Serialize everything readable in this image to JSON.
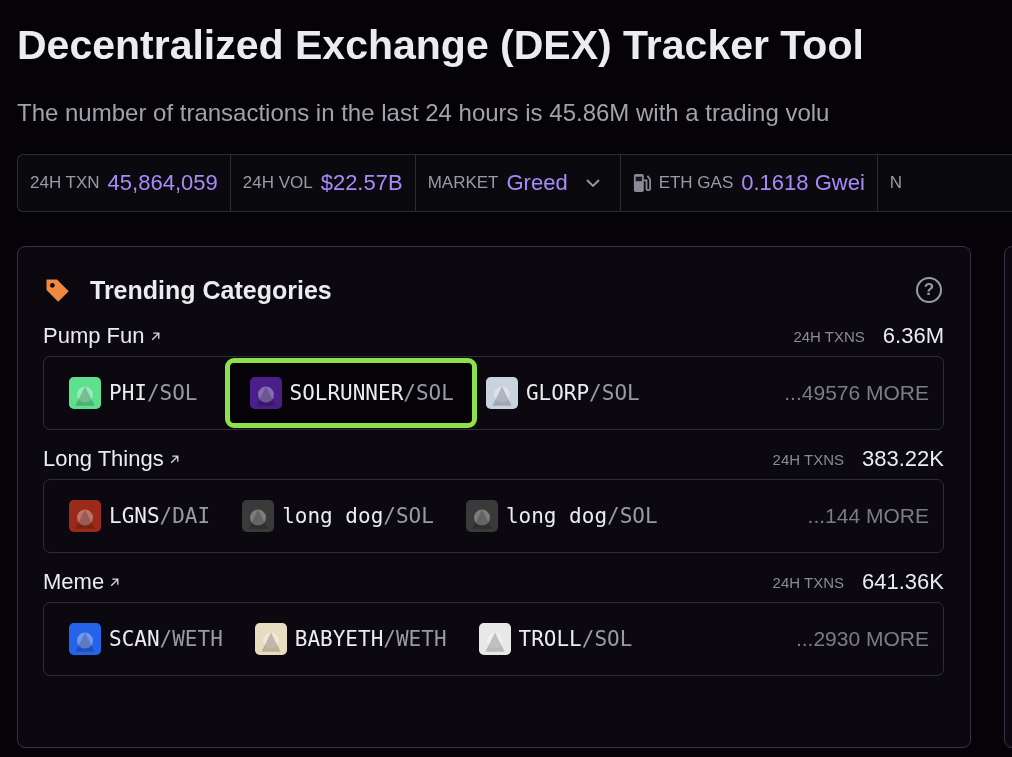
{
  "page": {
    "title": "Decentralized Exchange (DEX) Tracker Tool",
    "subtitle": "The number of transactions in the last 24 hours is 45.86M with a trading volu"
  },
  "stats": [
    {
      "kind": "plain",
      "label": "24H TXN",
      "value": "45,864,059"
    },
    {
      "kind": "plain",
      "label": "24H VOL",
      "value": "$22.57B"
    },
    {
      "kind": "dropdown",
      "label": "MARKET",
      "value": "Greed"
    },
    {
      "kind": "gas",
      "label": "ETH GAS",
      "value": "0.1618 Gwei"
    },
    {
      "kind": "plain",
      "label": "N"
    }
  ],
  "trending": {
    "title": "Trending Categories",
    "help": "?",
    "categories": [
      {
        "name": "Pump Fun",
        "metric_label": "24H TXNS",
        "metric": "6.36M",
        "more": "...49576 MORE",
        "pairs": [
          {
            "base": "PHI",
            "quote": "/SOL",
            "color": "#5ee08f",
            "highlighted": false
          },
          {
            "base": "SOLRUNNER",
            "quote": "/SOL",
            "color": "#4a1f8a",
            "highlighted": true
          },
          {
            "base": "GLORP",
            "quote": "/SOL",
            "color": "#c9d3e0",
            "highlighted": false
          }
        ]
      },
      {
        "name": "Long Things",
        "metric_label": "24H TXNS",
        "metric": "383.22K",
        "more": "...144 MORE",
        "pairs": [
          {
            "base": "LGNS",
            "quote": "/DAI",
            "color": "#9c2a1a",
            "highlighted": false
          },
          {
            "base": "long dog",
            "quote": "/SOL",
            "color": "#3a3a3a",
            "highlighted": false
          },
          {
            "base": "long dog",
            "quote": "/SOL",
            "color": "#3a3a3a",
            "highlighted": false
          }
        ]
      },
      {
        "name": "Meme",
        "metric_label": "24H TXNS",
        "metric": "641.36K",
        "more": "...2930 MORE",
        "pairs": [
          {
            "base": "SCAN",
            "quote": "/WETH",
            "color": "#2563eb",
            "highlighted": false
          },
          {
            "base": "BABYETH",
            "quote": "/WETH",
            "color": "#e8dcc0",
            "highlighted": false
          },
          {
            "base": "TROLL",
            "quote": "/SOL",
            "color": "#e8e8e8",
            "highlighted": false
          }
        ]
      }
    ]
  }
}
